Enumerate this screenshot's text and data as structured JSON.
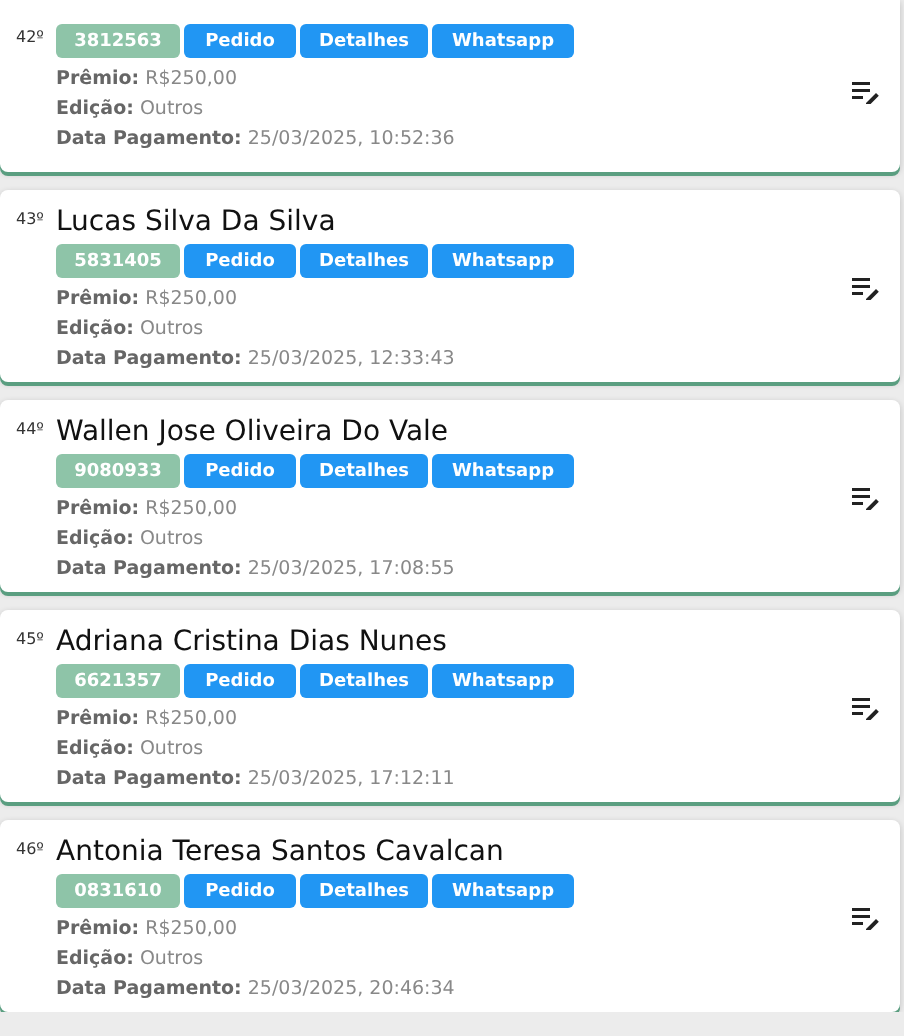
{
  "entries": [
    {
      "rank": "42º",
      "code": "3812563",
      "buttons": [
        "Pedido",
        "Detalhes",
        "Whatsapp"
      ],
      "lines": [
        "**Prêmio:** R$250,00",
        "**Edição:** Outros",
        "**Data Pagamento:** 25/03/2025, 10:52:36"
      ]
    },
    {
      "rank": "43º",
      "name": "Lucas Silva Da Silva",
      "code": "5831405",
      "buttons": [
        "Pedido",
        "Detalhes",
        "Whatsapp"
      ],
      "lines": [
        "**Prêmio:** R$250,00",
        "**Edição:** Outros",
        "**Data Pagamento:** 25/03/2025, 12:33:43"
      ]
    },
    {
      "rank": "44º",
      "name": "Wallen Jose Oliveira Do Vale",
      "code": "9080933",
      "buttons": [
        "Pedido",
        "Detalhes",
        "Whatsapp"
      ],
      "lines": [
        "**Prêmio:** R$250,00",
        "**Edição:** Outros",
        "**Data Pagamento:** 25/03/2025, 17:08:55"
      ]
    },
    {
      "rank": "45º",
      "name": "Adriana Cristina Dias Nunes",
      "code": "6621357",
      "buttons": [
        "Pedido",
        "Detalhes",
        "Whatsapp"
      ],
      "lines": [
        "**Prêmio:** R$250,00",
        "**Edição:** Outros",
        "**Data Pagamento:** 25/03/2025, 17:12:11"
      ]
    },
    {
      "rank": "46º",
      "name": "Antonia Teresa Santos Cavalcan",
      "code": "0831610",
      "buttons": [
        "Pedido",
        "Detalhes",
        "Whatsapp"
      ],
      "lines": [
        "**Prêmio:** R$250,00",
        "**Edição:** Outros",
        "**Data Pagamento:** 25/03/2025, 20:46:34"
      ]
    }
  ]
}
